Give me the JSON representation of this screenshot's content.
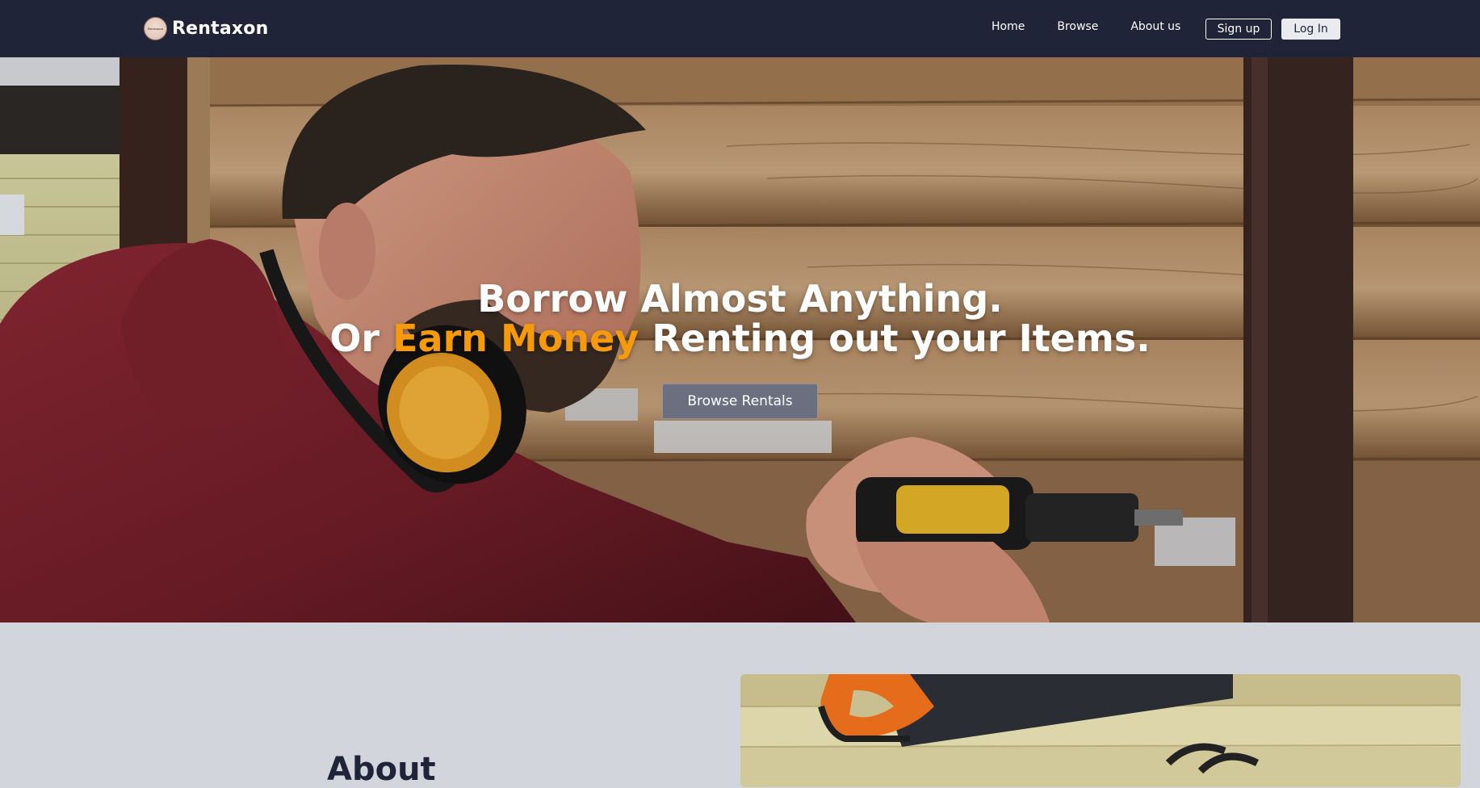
{
  "brand": {
    "name": "Rentaxon",
    "logo_text": "Rentaxon"
  },
  "nav": {
    "links": [
      "Home",
      "Browse",
      "About us"
    ],
    "signup_label": "Sign up",
    "login_label": "Log In"
  },
  "hero": {
    "line1": "Borrow Almost Anything.",
    "line2_prefix": "Or ",
    "line2_accent": "Earn Money",
    "line2_suffix": " Renting out your Items.",
    "cta_label": "Browse Rentals",
    "image": "man-with-drill-photo"
  },
  "about": {
    "heading": "About",
    "image": "hand-saw-photo"
  },
  "colors": {
    "navbar": "#1f2438",
    "accent": "#f59a0c",
    "page_background": "#d3d5dc",
    "cta_background": "#6b6f80"
  }
}
